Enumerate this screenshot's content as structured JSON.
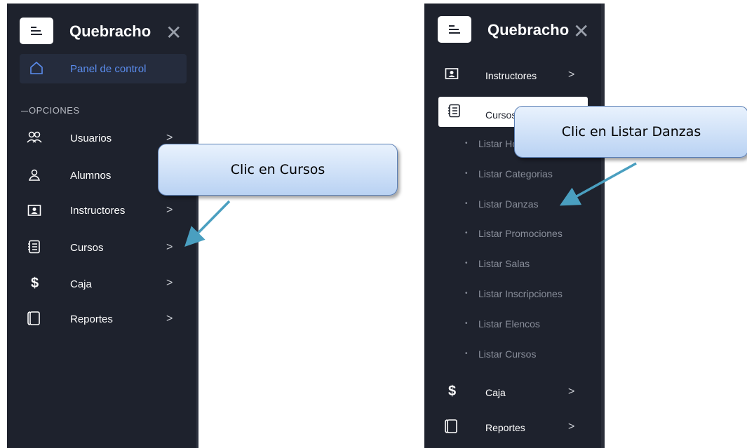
{
  "brand": {
    "name": "Quebracho"
  },
  "left_panel": {
    "active_item": "Panel de control",
    "section_label": "OPCIONES",
    "items": [
      {
        "label": "Usuarios",
        "icon": "users-icon"
      },
      {
        "label": "Alumnos",
        "icon": "user-icon"
      },
      {
        "label": "Instructores",
        "icon": "id-card-icon"
      },
      {
        "label": "Cursos",
        "icon": "list-icon"
      },
      {
        "label": "Caja",
        "icon": "dollar-icon"
      },
      {
        "label": "Reportes",
        "icon": "notebook-icon"
      }
    ]
  },
  "right_panel": {
    "items_top": [
      {
        "label": "Instructores",
        "icon": "id-card-icon"
      },
      {
        "label": "Cursos",
        "icon": "list-icon"
      }
    ],
    "sub_items": [
      "Listar Horarios",
      "Listar Categorias",
      "Listar Danzas",
      "Listar Promociones",
      "Listar Salas",
      "Listar Inscripciones",
      "Listar Elencos",
      "Listar Cursos"
    ],
    "items_bottom": [
      {
        "label": "Caja",
        "icon": "dollar-icon"
      },
      {
        "label": "Reportes",
        "icon": "notebook-icon"
      }
    ]
  },
  "callouts": {
    "left": "Clic en Cursos",
    "right": "Clic en Listar Danzas"
  },
  "colors": {
    "sidebar_bg": "#1e222d",
    "accent": "#5b8def",
    "callout_border": "#5b7fb5",
    "arrow": "#4a9fc0"
  }
}
